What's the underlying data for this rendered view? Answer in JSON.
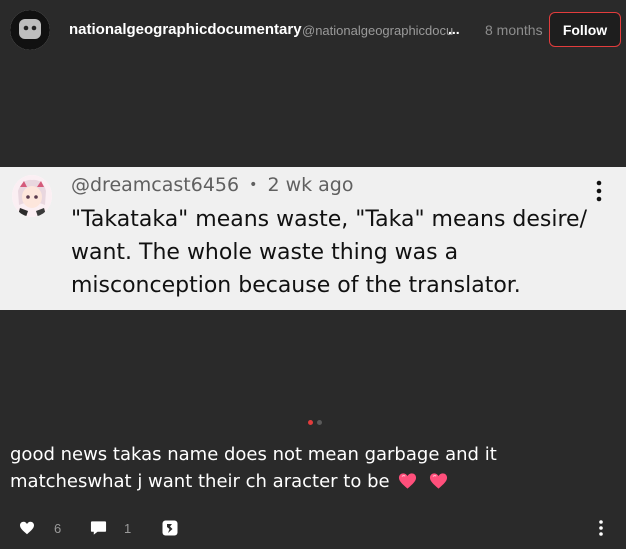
{
  "post": {
    "username": "nationalgeographicdocumentary",
    "handle": "@nationalgeographicdocu",
    "handle_ellipsis": "...",
    "time": "8 months",
    "follow_label": "Follow"
  },
  "comment": {
    "handle": "@dreamcast6456",
    "separator": "•",
    "age": "2 wk ago",
    "text": "\"Takataka\" means waste, \"Taka\" means desire/ want. The whole waste thing was a misconception because of the translator."
  },
  "carousel": {
    "pages": 2,
    "active_page": 1
  },
  "caption": {
    "text": "good news takas name does not mean garbage and it matcheswhat j want their ch aracter to be",
    "emoji": [
      "heart-icon",
      "heart-icon"
    ]
  },
  "actions": {
    "likes": "6",
    "comments": "1"
  },
  "colors": {
    "background": "#2a2a2a",
    "card": "#f0f0f0",
    "accent": "#e23c3c",
    "heart": "#ff4f7b"
  }
}
